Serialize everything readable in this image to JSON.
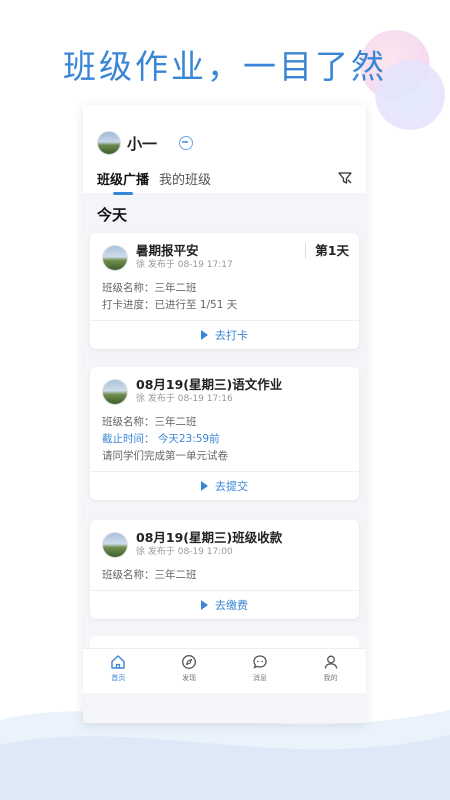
{
  "headline": "班级作业，一目了然",
  "user": {
    "name": "小一"
  },
  "tabs": [
    {
      "label": "班级广播",
      "active": true
    },
    {
      "label": "我的班级",
      "active": false
    }
  ],
  "section_title": "今天",
  "cards": [
    {
      "title": "暑期报平安",
      "meta": "徐 发布于 08-19 17:17",
      "badge": "第1天",
      "lines": [
        {
          "text": "班级名称：三年二班",
          "style": "normal"
        },
        {
          "text": "打卡进度：已进行至 1/51 天",
          "style": "normal"
        }
      ],
      "action": "去打卡"
    },
    {
      "title": "08月19(星期三)语文作业",
      "meta": "徐 发布于 08-19 17:16",
      "badge": "",
      "lines": [
        {
          "text": "班级名称：三年二班",
          "style": "normal"
        },
        {
          "text": "截止时间：  今天23:59前",
          "style": "blue"
        },
        {
          "text": "请同学们完成第一单元试卷",
          "style": "normal"
        }
      ],
      "action": "去提交"
    },
    {
      "title": "08月19(星期三)班级收款",
      "meta": "徐 发布于 08-19 17:00",
      "badge": "",
      "lines": [
        {
          "text": "班级名称：三年二班",
          "style": "normal"
        }
      ],
      "action": "去缴费"
    }
  ],
  "bottom_nav": [
    {
      "label": "首页",
      "icon": "home-icon",
      "active": true
    },
    {
      "label": "发现",
      "icon": "compass-icon",
      "active": false
    },
    {
      "label": "消息",
      "icon": "message-icon",
      "active": false
    },
    {
      "label": "我的",
      "icon": "profile-icon",
      "active": false
    }
  ],
  "colors": {
    "accent": "#3a86d6",
    "text": "#222222",
    "muted": "#999999",
    "background": "#f3f5f8"
  }
}
